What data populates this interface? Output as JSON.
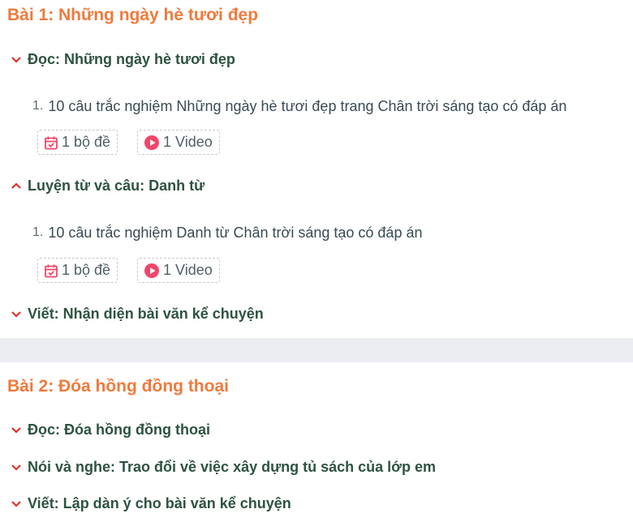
{
  "colors": {
    "title_orange": "#ef7a3c",
    "section_green": "#2e5340",
    "chevron_red": "#e0312b",
    "icon_pink": "#f0466a",
    "divider_gray": "#ebedf0"
  },
  "lessons": [
    {
      "title": "Bài 1: Những ngày hè tươi đẹp",
      "sections": [
        {
          "label": "Đọc: Những ngày hè tươi đẹp",
          "chevron": "chevron-down",
          "items": [
            {
              "number": "1.",
              "title": "10 câu trắc nghiệm Những ngày hè tươi đẹp trang Chân trời sáng tạo có đáp án",
              "exam_label": "1 bộ đề",
              "video_label": "1 Video"
            }
          ]
        },
        {
          "label": "Luyện từ và câu: Danh từ",
          "chevron": "chevron-up",
          "items": [
            {
              "number": "1.",
              "title": "10 câu trắc nghiệm Danh từ Chân trời sáng tạo có đáp án",
              "exam_label": "1 bộ đề",
              "video_label": "1 Video"
            }
          ]
        },
        {
          "label": "Viết: Nhận diện bài văn kể chuyện",
          "chevron": "chevron-down",
          "items": []
        }
      ]
    },
    {
      "title": "Bài 2: Đóa hồng đồng thoại",
      "sections": [
        {
          "label": "Đọc: Đóa hồng đồng thoại",
          "chevron": "chevron-down",
          "items": []
        },
        {
          "label": "Nói và nghe: Trao đổi về việc xây dựng tủ sách của lớp em",
          "chevron": "chevron-down",
          "items": []
        },
        {
          "label": "Viết: Lập dàn ý cho bài văn kể chuyện",
          "chevron": "chevron-down",
          "items": []
        }
      ]
    }
  ]
}
